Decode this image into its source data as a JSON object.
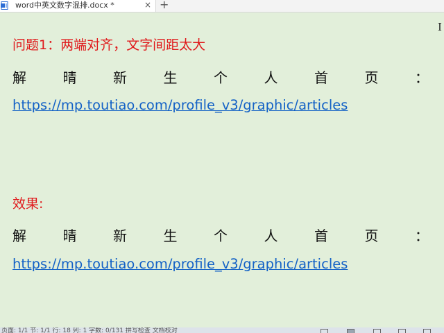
{
  "tab": {
    "title": "word中英文数字混排.docx *",
    "close": "×",
    "new_tab": "+",
    "icon": "document-icon"
  },
  "cursor": "I",
  "doc": {
    "heading1": "问题1：两端对齐，文字间距太大",
    "line1_chars": [
      "解",
      "晴",
      "新",
      "生",
      "个",
      "人",
      "首",
      "页",
      "："
    ],
    "link1": "https://mp.toutiao.com/profile_v3/graphic/articles",
    "heading2": "效果:",
    "line2_chars": [
      "解",
      "晴",
      "新",
      "生",
      "个",
      "人",
      "首",
      "页",
      "："
    ],
    "link2": "https://mp.toutiao.com/profile_v3/graphic/articles"
  },
  "statusbar": {
    "text": "页面: 1/1  节: 1/1  行: 18  列: 1  字数: 0/131  拼写检查  文档校对"
  },
  "colors": {
    "page_bg": "#e2efda",
    "heading": "#e0191b",
    "link": "#1462c6"
  }
}
